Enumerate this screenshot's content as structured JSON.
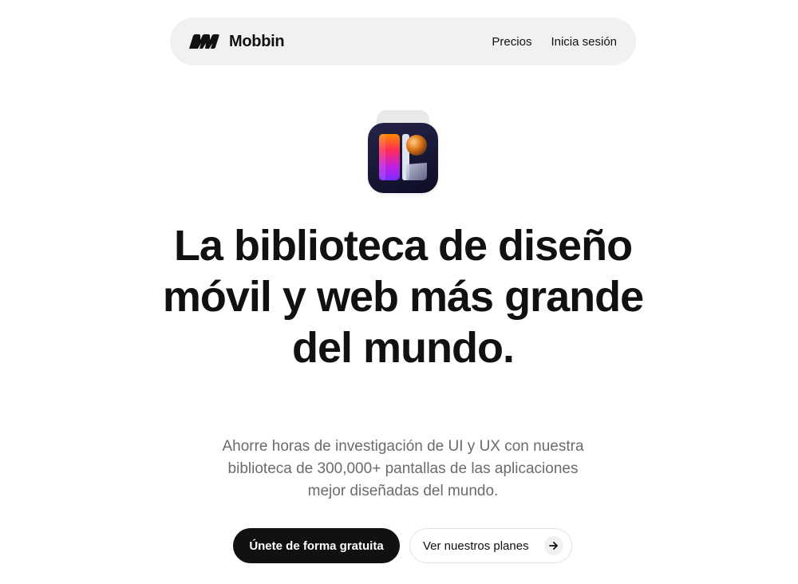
{
  "nav": {
    "brand_name": "Mobbin",
    "links": [
      "Precios",
      "Inicia sesión"
    ]
  },
  "hero": {
    "headline": "La biblioteca de diseño móvil y web más grande del mundo.",
    "subtitle": "Ahorre horas de investigación de UI y UX con nuestra biblioteca de 300,000+ pantallas de las aplicaciones mejor diseñadas del mundo.",
    "primary_cta": "Únete de forma gratuita",
    "secondary_cta": "Ver nuestros planes"
  },
  "icons": {
    "brand_logo": "mobbin-logo-icon",
    "app_icon": "app-icon",
    "cta_arrow": "arrow-right-icon"
  },
  "colors": {
    "nav_background": "#f1f1f1",
    "text_primary": "#111111",
    "text_secondary": "#6b6b6b",
    "button_primary": "#111111"
  }
}
